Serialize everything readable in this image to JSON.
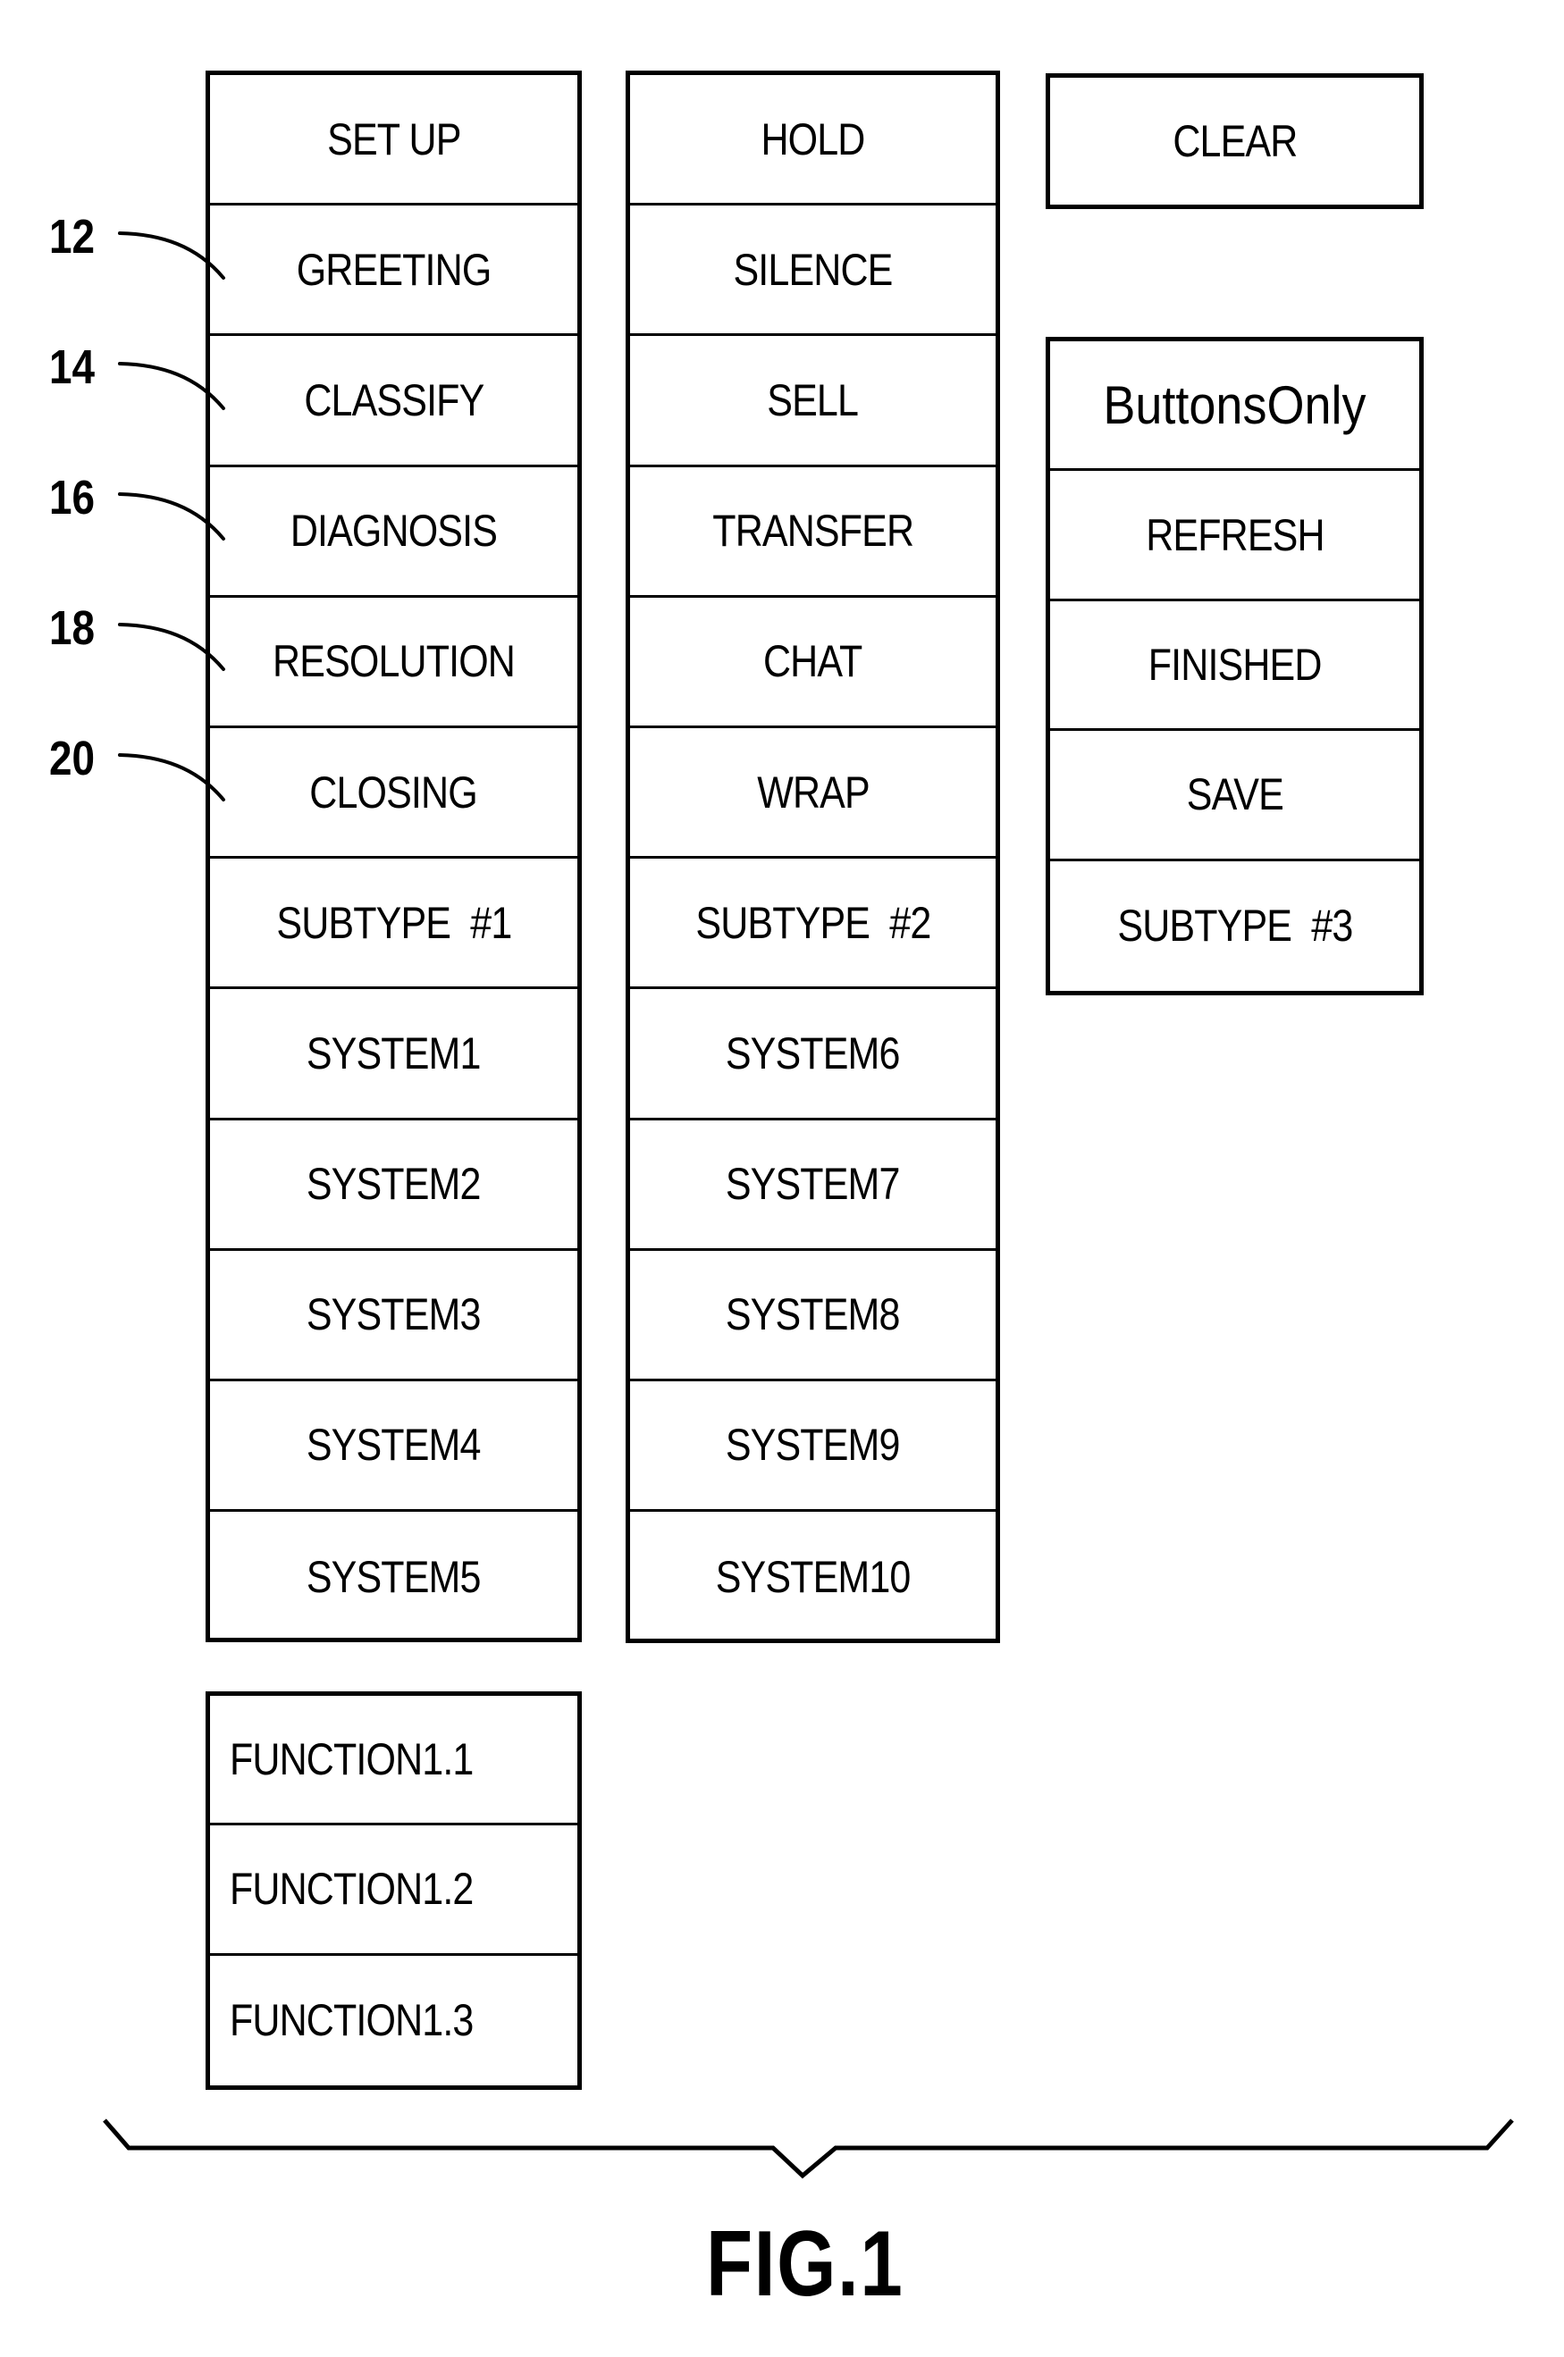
{
  "figure": {
    "caption": "FIG.1"
  },
  "columns": {
    "col1": {
      "buttons": [
        "SET UP",
        "GREETING",
        "CLASSIFY",
        "DIAGNOSIS",
        "RESOLUTION",
        "CLOSING",
        "SUBTYPE  #1",
        "SYSTEM1",
        "SYSTEM2",
        "SYSTEM3",
        "SYSTEM4",
        "SYSTEM5"
      ]
    },
    "col2": {
      "buttons": [
        "HOLD",
        "SILENCE",
        "SELL",
        "TRANSFER",
        "CHAT",
        "WRAP",
        "SUBTYPE  #2",
        "SYSTEM6",
        "SYSTEM7",
        "SYSTEM8",
        "SYSTEM9",
        "SYSTEM10"
      ]
    },
    "clear": {
      "label": "CLEAR"
    },
    "col3": {
      "buttons": [
        "ButtonsOnly",
        "REFRESH",
        "FINISHED",
        "SAVE",
        "SUBTYPE  #3"
      ]
    },
    "functions": {
      "buttons": [
        "FUNCTION1.1",
        "FUNCTION1.2",
        "FUNCTION1.3"
      ]
    }
  },
  "callouts": [
    {
      "ref": "12",
      "target": "GREETING"
    },
    {
      "ref": "14",
      "target": "CLASSIFY"
    },
    {
      "ref": "16",
      "target": "DIAGNOSIS"
    },
    {
      "ref": "18",
      "target": "RESOLUTION"
    },
    {
      "ref": "20",
      "target": "CLOSING"
    }
  ]
}
